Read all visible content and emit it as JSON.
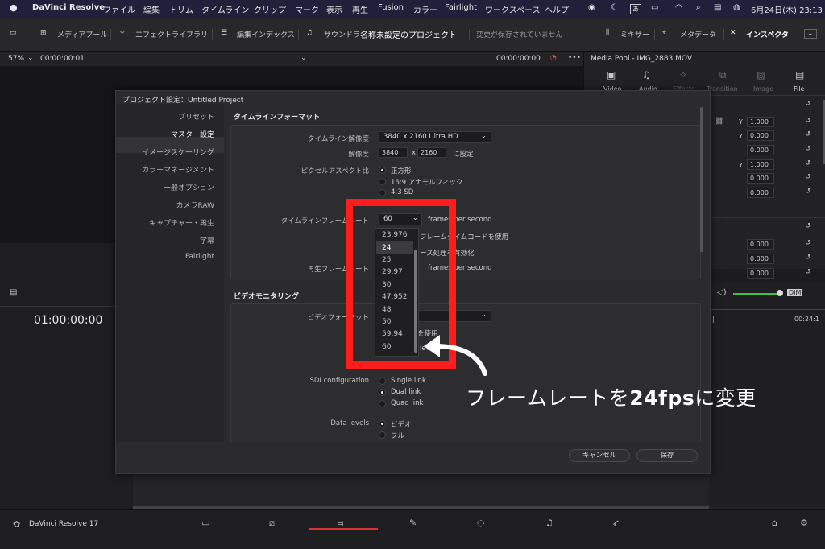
{
  "menubar": {
    "app": "DaVinci Resolve",
    "items": [
      "ファイル",
      "編集",
      "トリム",
      "タイムライン",
      "クリップ",
      "マーク",
      "表示",
      "再生",
      "Fusion",
      "カラー",
      "Fairlight",
      "ワークスペース",
      "ヘルプ"
    ],
    "input_indicator": "あ",
    "clock": "6月24日(木)  23:13"
  },
  "toolbar": {
    "media_pool": "メディアプール",
    "effects_library": "エフェクトライブラリ",
    "edit_index": "編集インデックス",
    "sound_library": "サウンドラ",
    "project_title": "名称未設定のプロジェクト",
    "save_status": "変更が保存されていません",
    "mixer": "ミキサー",
    "metadata": "メタデータ",
    "inspector": "インスペクタ"
  },
  "viewer": {
    "zoom": "57%",
    "timecode_left": "00:00:00:01",
    "timecode_right": "00:00:00:00",
    "timeline_timecode": "01:00:00:00"
  },
  "media_pool_panel": {
    "title": "Media Pool - IMG_2883.MOV",
    "tabs": [
      "Video",
      "Audio",
      "Effects",
      "Transition",
      "Image",
      "File"
    ],
    "y_labels": [
      "Y",
      "Y",
      "Y"
    ],
    "values": [
      "1.000",
      "1.000",
      "0.000",
      "1.000",
      "0.000",
      "0.000"
    ],
    "lower_values": [
      "0.000",
      "0.000",
      "0.000"
    ],
    "dim_label": "DIM",
    "ruler_time": "00:24:1"
  },
  "dialog": {
    "title": "プロジェクト設定：Untitled Project",
    "sidebar": [
      "プリセット",
      "マスター設定",
      "イメージスケーリング",
      "カラーマネージメント",
      "一般オプション",
      "カメラRAW",
      "キャプチャー・再生",
      "字幕",
      "Fairlight"
    ],
    "section_timeline_format": "タイムラインフォーマット",
    "timeline_resolution_label": "タイムライン解像度",
    "timeline_resolution_value": "3840 x 2160 Ultra HD",
    "resolution_label": "解像度",
    "resolution_w": "3840",
    "resolution_x": "x",
    "resolution_h": "2160",
    "resolution_suffix": "に設定",
    "pixel_aspect_label": "ピクセルアスペクト比",
    "pixel_aspect_options": [
      "正方形",
      "16:9 アナモルフィック",
      "4:3 SD"
    ],
    "timeline_fps_label": "タイムラインフレームレート",
    "timeline_fps_value": "60",
    "fps_unit": "frames per second",
    "drop_frame_text": "フレームタイムコードを使用",
    "interlace_text": "ース処理を有効化",
    "playback_fps_label": "再生フレームレート",
    "playback_fps_unit": "frames per second",
    "section_video_monitoring": "ビデオモニタリング",
    "video_format_label": "ビデオフォーマット",
    "video_format_value": "",
    "use_text": "を使用",
    "level_text": "level",
    "sdi_label": "SDI configuration",
    "sdi_options": [
      "Single link",
      "Dual link",
      "Quad link"
    ],
    "data_levels_label": "Data levels",
    "data_levels_options": [
      "ビデオ",
      "フル"
    ],
    "cancel": "キャンセル",
    "save": "保存"
  },
  "fps_dropdown": {
    "options": [
      "23.976",
      "24",
      "25",
      "29.97",
      "30",
      "47.952",
      "48",
      "50",
      "59.94",
      "60"
    ],
    "selected": "24"
  },
  "annotation": {
    "text_before": "フレームレートを",
    "text_bold": "24fps",
    "text_after": "に変更"
  },
  "bottombar": {
    "app_name": "DaVinci Resolve 17"
  },
  "colors": {
    "highlight_red": "#ff1c1c",
    "accent_green": "#3fbf3f",
    "active_tab_red": "#d83232"
  }
}
